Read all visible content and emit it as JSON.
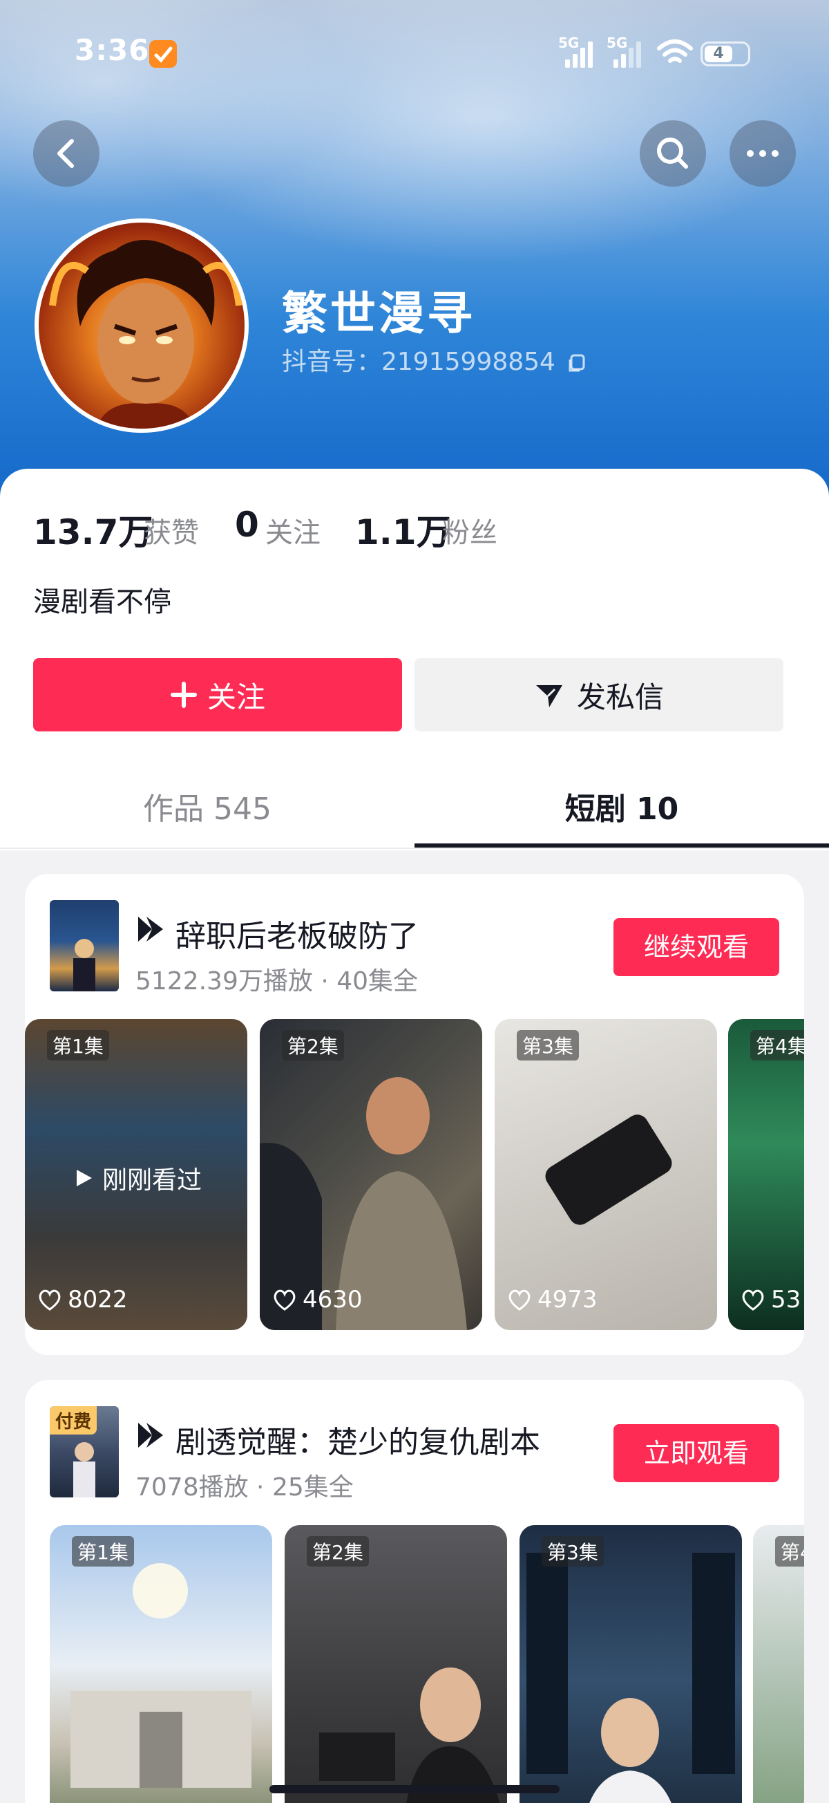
{
  "status_bar": {
    "time": "3:36",
    "notification_badge": "",
    "network_1": "5G",
    "network_2": "5G",
    "battery": "4"
  },
  "header": {
    "back_icon": "back-arrow-icon",
    "search_icon": "search-icon",
    "more_icon": "more-icon"
  },
  "profile": {
    "name": "繁世漫寻",
    "douyin_id": "抖音号：21915998854",
    "stats": {
      "likes_value": "13.7万",
      "likes_label": "获赞",
      "following_value": "0",
      "following_label": "关注",
      "followers_value": "1.1万",
      "followers_label": "粉丝"
    },
    "bio": "漫剧看不停",
    "follow_label": "关注",
    "message_label": "发私信"
  },
  "tabs": [
    {
      "label": "作品 545",
      "active": false
    },
    {
      "label": "短剧 10",
      "active": true
    }
  ],
  "dramas": [
    {
      "title": "辞职后老板破防了",
      "meta": "5122.39万播放 · 40集全",
      "button": "继续观看",
      "paid_tag": "",
      "episodes": [
        {
          "label": "第1集",
          "likes": "8022",
          "watched": "刚刚看过"
        },
        {
          "label": "第2集",
          "likes": "4630"
        },
        {
          "label": "第3集",
          "likes": "4973"
        },
        {
          "label": "第4集",
          "likes": "53"
        }
      ]
    },
    {
      "title": "剧透觉醒：楚少的复仇剧本",
      "meta": "7078播放 · 25集全",
      "button": "立即观看",
      "paid_tag": "付费",
      "episodes": [
        {
          "label": "第1集"
        },
        {
          "label": "第2集"
        },
        {
          "label": "第3集"
        },
        {
          "label": "第4"
        }
      ]
    }
  ],
  "colors": {
    "accent": "#fe2c55",
    "banner_top": "#b8c9df",
    "banner_bottom": "#1366c9",
    "text_primary": "#161823",
    "text_secondary": "#8a8b91"
  }
}
